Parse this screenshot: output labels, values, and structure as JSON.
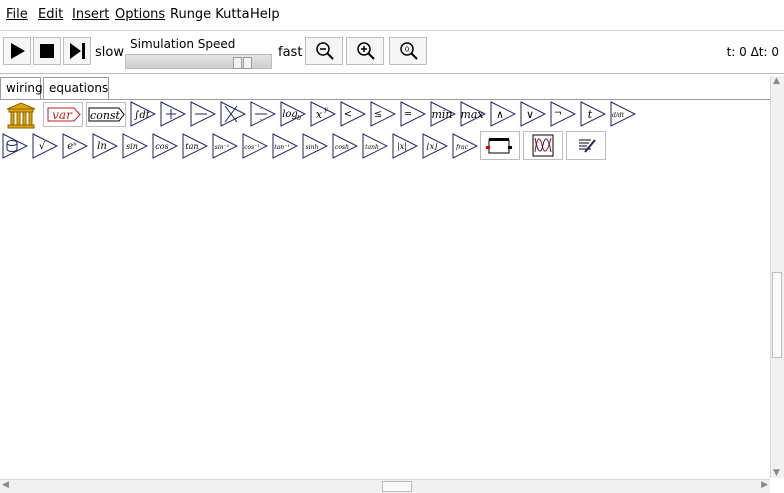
{
  "menu": {
    "file": "File",
    "edit": "Edit",
    "insert": "Insert",
    "options": "Options",
    "runge_kutta": "Runge Kutta",
    "help": "Help"
  },
  "toolbar": {
    "slow_label": "slow",
    "speed_title": "Simulation Speed",
    "fast_label": "fast",
    "speed_value": 0.85,
    "zoom_reset_label": "0",
    "status": "t: 0 Δt: 0"
  },
  "tabs": [
    {
      "label": "wiring",
      "active": false
    },
    {
      "label": "equations",
      "active": true
    }
  ],
  "palette": {
    "row1": [
      "godley-table-icon",
      "variable-icon",
      "constant-icon",
      "integral-icon",
      "add-icon",
      "subtract-icon",
      "multiply-icon",
      "divide-icon",
      "log-icon",
      "power-icon",
      "less-than-icon",
      "less-equal-icon",
      "equal-icon",
      "min-icon",
      "max-icon",
      "and-icon",
      "or-icon",
      "not-icon",
      "time-icon",
      "derivative-icon"
    ],
    "row1_labels": {
      "variable": "var",
      "constant": "const",
      "integral": "∫dt",
      "log": "log",
      "log_sub": "b",
      "power": "x",
      "power_sup": "y",
      "min": "min",
      "max": "max",
      "time": "t",
      "derivative": "d/dt"
    },
    "row2_labels": [
      "√",
      "eˣ",
      "ln",
      "sin",
      "cos",
      "tan",
      "sin⁻¹",
      "cos⁻¹",
      "tan⁻¹",
      "sinh",
      "cosh",
      "tanh",
      "|x|",
      "⌊x⌋",
      "frac"
    ],
    "row2_extras": [
      "plot-widget-icon",
      "sheet-widget-icon",
      "note-widget-icon"
    ]
  }
}
